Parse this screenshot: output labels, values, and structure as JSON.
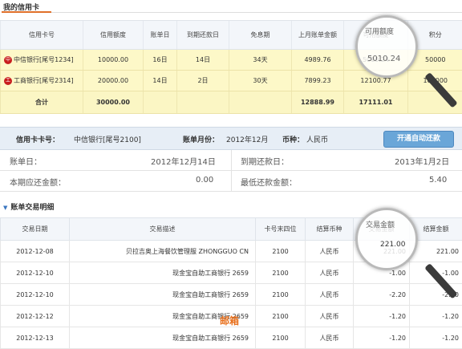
{
  "section_title": "我的信用卡",
  "cards_table": {
    "headers": [
      "信用卡号",
      "信用额度",
      "账单日",
      "到期还款日",
      "免息期",
      "上月账单金额",
      "可用额度",
      "积分"
    ],
    "rows": [
      {
        "logo": "中",
        "bank": "中信银行[尾号1234]",
        "limit": "10000.00",
        "bill_day": "16日",
        "due_day": "14日",
        "free_period": "34天",
        "last_bill": "4989.76",
        "available": "5010.24",
        "points": "50000"
      },
      {
        "logo": "工",
        "bank": "工商银行[尾号2314]",
        "limit": "20000.00",
        "bill_day": "14日",
        "due_day": "2日",
        "free_period": "30天",
        "last_bill": "7899.23",
        "available": "12100.77",
        "points": "100000"
      }
    ],
    "total": {
      "label": "合计",
      "limit": "30000.00",
      "last_bill": "12888.99",
      "available": "17111.01"
    }
  },
  "info_bar": {
    "card_label": "信用卡卡号：",
    "card_value": "中信银行[尾号2100]",
    "month_label": "账单月份：",
    "month_value": "2012年12月",
    "currency_label": "币种：",
    "currency_value": "人民币",
    "auto_button": "开通自动还款"
  },
  "summary": {
    "bill_day_label": "账单日：",
    "bill_day_value": "2012年12月14日",
    "due_label": "到期还款日：",
    "due_value": "2013年1月2日",
    "current_label": "本期应还金额：",
    "current_value": "0.00",
    "min_label": "最低还款金额：",
    "min_value": "5.40"
  },
  "tx_section_title": "账单交易明细",
  "tx_table": {
    "headers": [
      "交易日期",
      "交易描述",
      "卡号末四位",
      "结算币种",
      "交易金额",
      "结算金额"
    ],
    "rows": [
      {
        "date": "2012-12-08",
        "desc": "贝拉吉奥上海餐饮管理服 ZHONGGUO CN",
        "card": "2100",
        "currency": "人民币",
        "amount": "221.00",
        "settle": "221.00"
      },
      {
        "date": "2012-12-10",
        "desc": "现金宝自助工商银行 2659",
        "card": "2100",
        "currency": "人民币",
        "amount": "-1.00",
        "settle": "-1.00"
      },
      {
        "date": "2012-12-10",
        "desc": "现金宝自助工商银行 2659",
        "card": "2100",
        "currency": "人民币",
        "amount": "-2.20",
        "settle": "-2.20"
      },
      {
        "date": "2012-12-12",
        "desc": "现金宝自助工商银行 2659",
        "card": "2100",
        "currency": "人民币",
        "amount": "-1.20",
        "settle": "-1.20"
      },
      {
        "date": "2012-12-13",
        "desc": "现金宝自助工商银行 2659",
        "card": "2100",
        "currency": "人民币",
        "amount": "-1.20",
        "settle": "-1.20"
      }
    ]
  },
  "watermark": "邮箱"
}
